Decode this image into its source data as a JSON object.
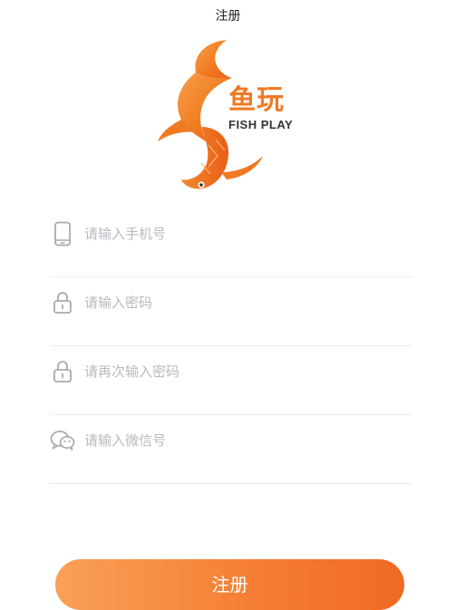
{
  "header": {
    "title": "注册"
  },
  "logo": {
    "name_cn": "鱼玩",
    "name_en": "FISH PLAY",
    "icon": "goldfish-logo",
    "brand_color": "#f07a24"
  },
  "form": {
    "phone": {
      "placeholder": "请输入手机号",
      "icon": "phone-icon",
      "value": ""
    },
    "password": {
      "placeholder": "请输入密码",
      "icon": "lock-icon",
      "value": ""
    },
    "confirm_password": {
      "placeholder": "请再次输入密码",
      "icon": "lock-icon",
      "value": ""
    },
    "wechat": {
      "placeholder": "请输入微信号",
      "icon": "wechat-icon",
      "value": ""
    }
  },
  "submit": {
    "label": "注册",
    "gradient": [
      "#f9a057",
      "#f06a22"
    ]
  }
}
